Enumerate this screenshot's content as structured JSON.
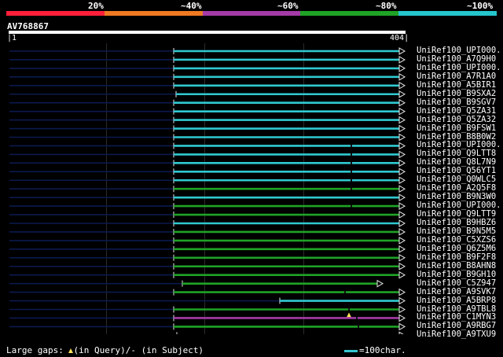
{
  "legend": {
    "labels": [
      "20%",
      "~40%",
      "~60%",
      "~80%",
      "~100%"
    ],
    "colors": [
      "#ff1f3a",
      "#ef7a23",
      "#a43ba6",
      "#1fa326",
      "#25c5cc"
    ]
  },
  "query": {
    "id": "AV768867",
    "start": "1",
    "end": "404"
  },
  "hits": [
    {
      "name": "UniRef100_UPI000..",
      "color": "#30c9d1"
    },
    {
      "name": "UniRef100_A7Q9H0",
      "color": "#30c9d1"
    },
    {
      "name": "UniRef100_UPI000..",
      "color": "#30c9d1"
    },
    {
      "name": "UniRef100_A7R1A0",
      "color": "#30c9d1"
    },
    {
      "name": "UniRef100_A5BIR1",
      "color": "#30c9d1"
    },
    {
      "name": "UniRef100_B9SXA2",
      "color": "#30c9d1"
    },
    {
      "name": "UniRef100_B9SGV7",
      "color": "#30c9d1"
    },
    {
      "name": "UniRef100_Q5ZA31",
      "color": "#30c9d1"
    },
    {
      "name": "UniRef100_Q5ZA32",
      "color": "#30c9d1"
    },
    {
      "name": "UniRef100_B9FSW1",
      "color": "#30c9d1"
    },
    {
      "name": "UniRef100_B8B0W2",
      "color": "#30c9d1"
    },
    {
      "name": "UniRef100_UPI000..",
      "color": "#30c9d1"
    },
    {
      "name": "UniRef100_Q9LTT8",
      "color": "#30c9d1"
    },
    {
      "name": "UniRef100_Q8L7N9",
      "color": "#30c9d1"
    },
    {
      "name": "UniRef100_Q56YT1",
      "color": "#30c9d1"
    },
    {
      "name": "UniRef100_Q0WLC5",
      "color": "#30c9d1"
    },
    {
      "name": "UniRef100_A2Q5F8",
      "color": "#1fa326"
    },
    {
      "name": "UniRef100_B9N3W0",
      "color": "#30c9d1"
    },
    {
      "name": "UniRef100_UPI000..",
      "color": "#1fa326"
    },
    {
      "name": "UniRef100_Q9LTT9",
      "color": "#1fa326"
    },
    {
      "name": "UniRef100_B9HBZ6",
      "color": "#30c9d1"
    },
    {
      "name": "UniRef100_B9N5M5",
      "color": "#1fa326"
    },
    {
      "name": "UniRef100_C5XZS6",
      "color": "#1fa326"
    },
    {
      "name": "UniRef100_Q6Z5M6",
      "color": "#1fa326"
    },
    {
      "name": "UniRef100_B9F2F8",
      "color": "#1fa326"
    },
    {
      "name": "UniRef100_B8AHN8",
      "color": "#1fa326"
    },
    {
      "name": "UniRef100_B9GH10",
      "color": "#1fa326"
    },
    {
      "name": "UniRef100_C5Z947",
      "color": "#1fa326"
    },
    {
      "name": "UniRef100_A9SVK7",
      "color": "#1fa326"
    },
    {
      "name": "UniRef100_A5BRP8",
      "color": "#30c9d1"
    },
    {
      "name": "UniRef100_A9TBL8",
      "color": "#1fa326"
    },
    {
      "name": "UniRef100_C1MYN3",
      "color": "#a43ba6"
    },
    {
      "name": "UniRef100_A9RBG7",
      "color": "#1fa326"
    },
    {
      "name": "UniRef100_A9TXU9",
      "color": "#a43ba6"
    }
  ],
  "footer": {
    "gaps_prefix": "Large gaps:",
    "gaps_query": "(in Query)/",
    "gaps_subject": "- (in Subject)",
    "scale_label": "=100char."
  }
}
